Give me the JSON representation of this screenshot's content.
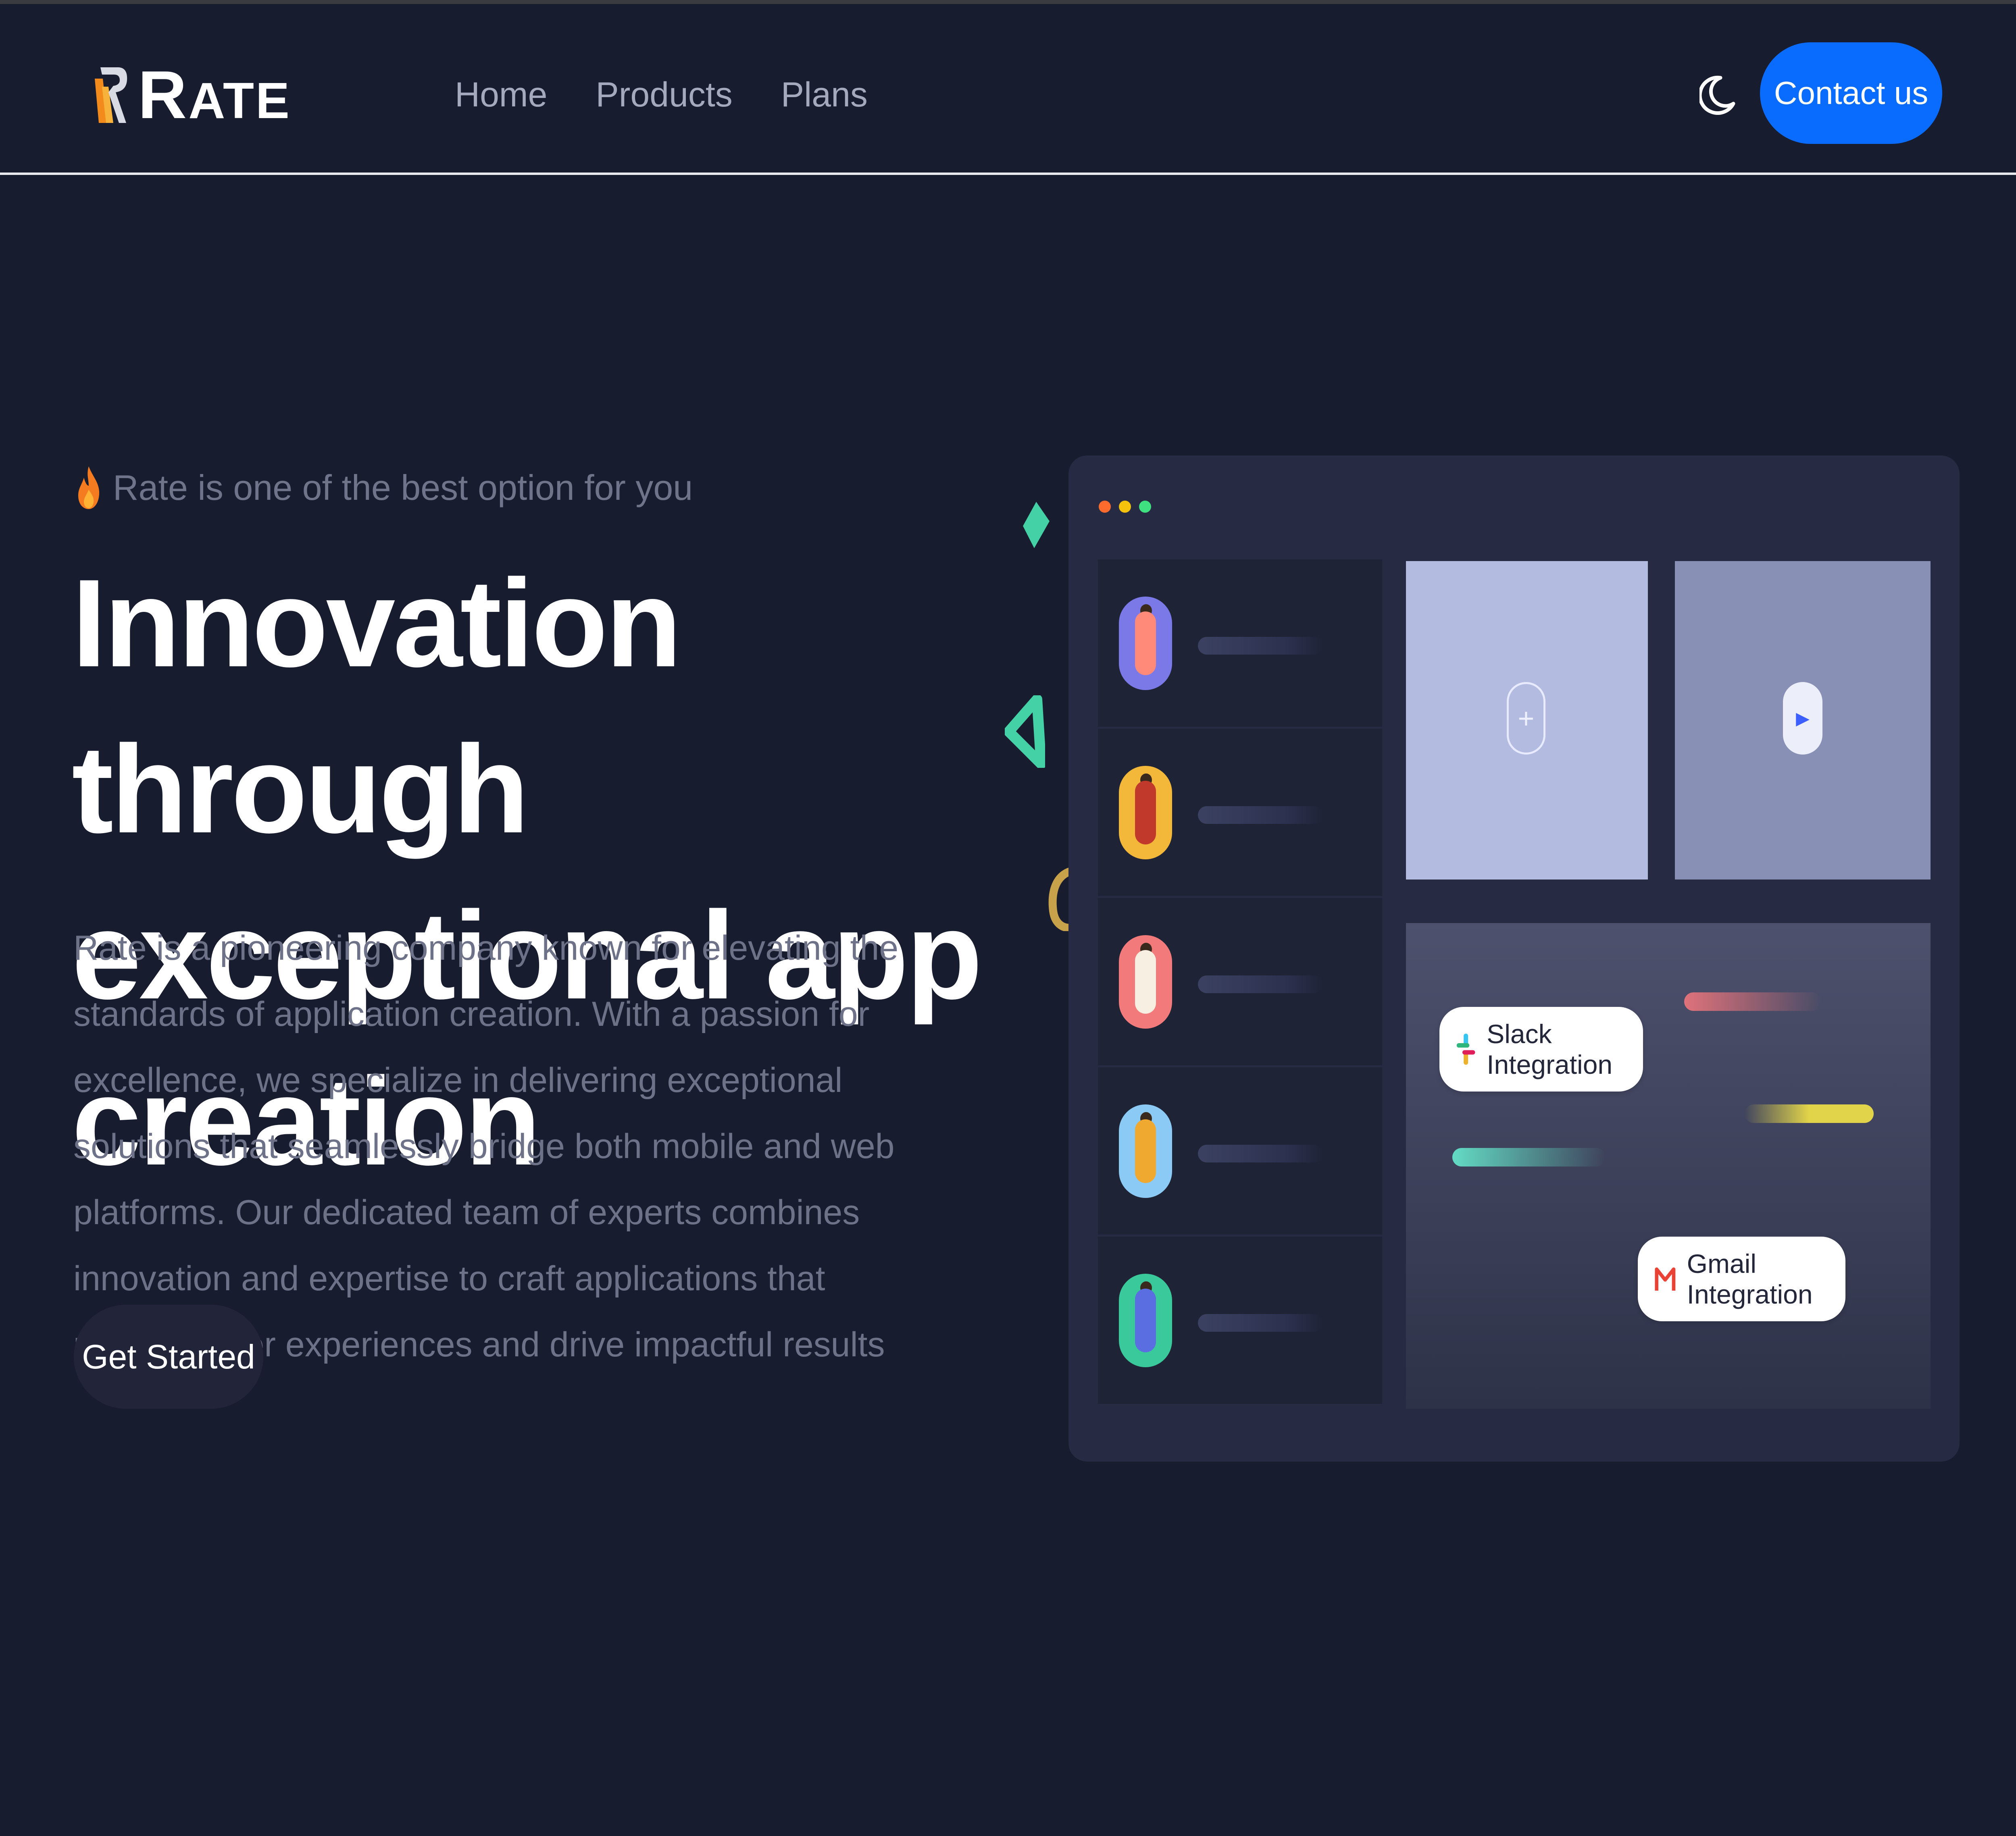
{
  "brand": {
    "name_first": "R",
    "name_rest": "ATE"
  },
  "nav": {
    "links": [
      "Home",
      "Products",
      "Plans"
    ],
    "theme_toggle_icon": "moon-icon",
    "contact_label": "Contact us"
  },
  "hero": {
    "eyebrow": "Rate is one of the best option for you",
    "title_line1": "Innovation through",
    "title_line2": "exceptional app creation",
    "description": "Rate is a pioneering company known for elevating the standards of application creation. With a passion for excellence, we specialize in delivering exceptional solutions that seamlessly bridge both mobile and web platforms. Our dedicated team of experts combines innovation and expertise to craft applications that redefine user experiences and drive impactful results",
    "cta_label": "Get Started"
  },
  "mockup": {
    "integrations": {
      "slack": "Slack Integration",
      "gmail": "Gmail Integration"
    },
    "plus_symbol": "+",
    "play_symbol": "▶"
  },
  "colors": {
    "background": "#181c2f",
    "accent": "#0a6cff",
    "flame": "#f47b20",
    "dot_red": "#ff6b2c",
    "dot_yellow": "#f4c20d",
    "dot_green": "#3ee07f"
  }
}
